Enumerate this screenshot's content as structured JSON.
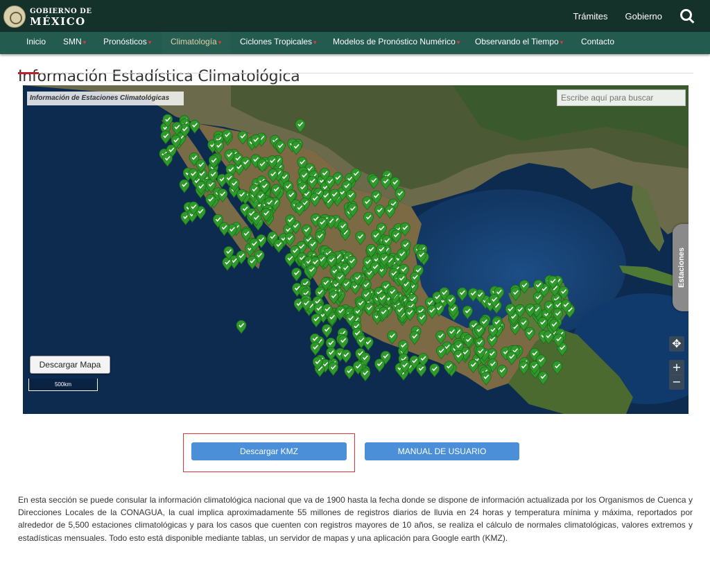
{
  "header": {
    "logo_line1": "GOBIERNO DE",
    "logo_line2": "MÉXICO",
    "links": [
      "Trámites",
      "Gobierno"
    ],
    "search_icon": "search-icon"
  },
  "nav": {
    "items": [
      {
        "label": "Inicio",
        "dropdown": false,
        "active": false
      },
      {
        "label": "SMN",
        "dropdown": true,
        "active": false
      },
      {
        "label": "Pronósticos",
        "dropdown": true,
        "active": false
      },
      {
        "label": "Climatología",
        "dropdown": true,
        "active": true
      },
      {
        "label": "Ciclones Tropicales",
        "dropdown": true,
        "active": false
      },
      {
        "label": "Modelos de Pronóstico Numérico",
        "dropdown": true,
        "active": false
      },
      {
        "label": "Observando el Tiempo",
        "dropdown": true,
        "active": false
      },
      {
        "label": "Contacto",
        "dropdown": false,
        "active": false
      }
    ]
  },
  "page": {
    "title": "Información Estadística Climatológica"
  },
  "map": {
    "panel_title": "Información de Estaciones Climatológicas",
    "search_placeholder": "Escribe aquí para buscar",
    "stations_tab": "Estaciones",
    "download_map": "Descargar Mapa",
    "scale": "500km",
    "zoom_in": "+",
    "zoom_out": "−",
    "pan": "✥"
  },
  "buttons": {
    "kmz": "Descargar KMZ",
    "manual": "MANUAL DE USUARIO"
  },
  "description": "En esta sección se puede consular la información climatológica nacional que va de 1900 hasta la fecha donde se dispone de información actualizada por los Organismos de Cuenca y Direcciones Locales de la CONAGUA, la cual implica aproximadamente 55 millones de registros diarios de lluvia en 24 horas y temperatura mínima y máxima, reportados por alrededor de 5,500 estaciones climatológicas y para los casos que cuenten con registros mayores de 10 años, se realiza el cálculo de normales climatológicas, valores extremos y estadísticas mensuales. Todo esto está disponible mediante tablas, un servidor de mapas y una aplicación para Google earth (KMZ).",
  "colors": {
    "topbar": "#14312a",
    "navbar": "#235b4e",
    "active_nav_text": "#dcd2a7",
    "accent_red": "#b8232f",
    "button_blue": "#4b8fd8",
    "marker_green": "#2f9a2b"
  }
}
